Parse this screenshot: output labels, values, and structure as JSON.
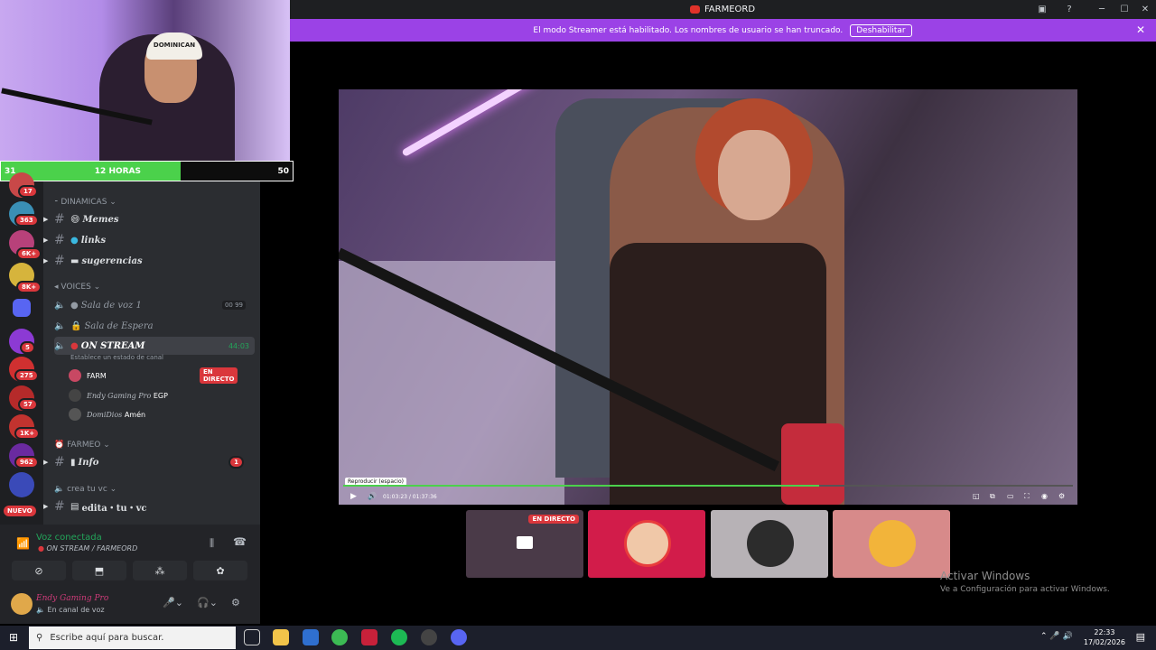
{
  "window": {
    "title": "FARMEORD"
  },
  "banner": {
    "text": "El modo Streamer está habilitado. Los nombres de usuario se han truncado.",
    "button": "Deshabilitar"
  },
  "overlay": {
    "left_count": "31",
    "center": "12 HORAS",
    "right_count": "50",
    "cap_text": "DOMINICAN"
  },
  "servers": {
    "badges": [
      "17",
      "363",
      "6K+",
      "8K+",
      "5",
      "275",
      "57",
      "1K+",
      "962"
    ],
    "nuevo": "NUEVO"
  },
  "channels": {
    "cat_dinamicas": "DINAMICAS",
    "memes": "Memes",
    "links": "links",
    "sugerencias": "sugerencias",
    "cat_voices": "VOICES",
    "sala_voz": "Sala de voz 1",
    "sala_voz_counts": "00 99",
    "sala_espera": "Sala de Espera",
    "on_stream": "ON STREAM",
    "on_stream_time": "44:03",
    "status_hint": "Establece un estado de canal",
    "user1": "FARM",
    "user1_live": "EN DIRECTO",
    "user2": "Endy Gaming Pro",
    "user2_tag": "EGP",
    "user3": "DomiDios",
    "user3_tag": "Amén",
    "cat_farmeo": "FARMEO",
    "info": "Info",
    "info_badge": "1",
    "cat_crea": "crea tu vc",
    "edita": "edita・tu・vc"
  },
  "voice_panel": {
    "status": "Voz conectada",
    "channel": "ON STREAM / FARMEORD",
    "user_name": "Endy Gaming Pro",
    "user_status": "En canal de voz"
  },
  "player": {
    "tooltip": "Reproducir (espacio)",
    "time": "01:03:23 / 01:37:36",
    "progress": 0.652
  },
  "tiles": {
    "live_label": "EN DIRECTO"
  },
  "watermark": {
    "line1": "Activar Windows",
    "line2": "Ve a Configuración para activar Windows."
  },
  "taskbar": {
    "search_placeholder": "Escribe aquí para buscar.",
    "time": "22:33",
    "date": "17/02/2026"
  },
  "colors": {
    "accent": "#9b42e6",
    "progress": "#4bd14b",
    "live": "#da373c",
    "voice_green": "#23a55a"
  }
}
